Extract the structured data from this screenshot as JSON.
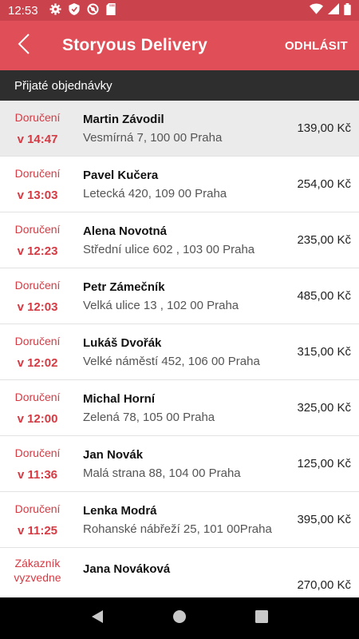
{
  "status_bar": {
    "time": "12:53",
    "icons": [
      "gear-icon",
      "shield-icon",
      "no-tracking-icon",
      "sd-card-icon"
    ],
    "right_icons": [
      "wifi-icon",
      "signal-icon",
      "battery-icon"
    ]
  },
  "app_bar": {
    "title": "Storyous Delivery",
    "logout_label": "ODHLÁSIT",
    "color": "#e04f57"
  },
  "section": {
    "title": "Přijaté objednávky"
  },
  "orders": [
    {
      "type": "Doručení",
      "time": "v 14:47",
      "name": "Martin Závodil",
      "address": "Vesmírná 7, 100 00 Praha",
      "price": "139,00 Kč"
    },
    {
      "type": "Doručení",
      "time": "v 13:03",
      "name": "Pavel Kučera",
      "address": "Letecká 420, 109 00 Praha",
      "price": "254,00 Kč"
    },
    {
      "type": "Doručení",
      "time": "v 12:23",
      "name": "Alena Novotná",
      "address": "Střední ulice 602 , 103 00 Praha",
      "price": "235,00 Kč"
    },
    {
      "type": "Doručení",
      "time": "v 12:03",
      "name": "Petr Zámečník",
      "address": "Velká ulice 13 , 102 00 Praha",
      "price": "485,00 Kč"
    },
    {
      "type": "Doručení",
      "time": "v 12:02",
      "name": "Lukáš Dvořák",
      "address": "Velké náměstí 452, 106 00 Praha",
      "price": "315,00 Kč"
    },
    {
      "type": "Doručení",
      "time": "v 12:00",
      "name": "Michal Horní",
      "address": "Zelená 78, 105 00 Praha",
      "price": "325,00 Kč"
    },
    {
      "type": "Doručení",
      "time": "v 11:36",
      "name": "Jan Novák",
      "address": "Malá strana 88, 104 00 Praha",
      "price": "125,00 Kč"
    },
    {
      "type": "Doručení",
      "time": "v 11:25",
      "name": "Lenka Modrá",
      "address": "Rohanské nábřeží 25, 101 00Praha",
      "price": "395,00 Kč"
    },
    {
      "type": "Zákazník vyzvedne",
      "time": "",
      "name": "Jana Nováková",
      "address": "",
      "price": "270,00 Kč"
    }
  ],
  "nav_bar": {
    "buttons": [
      "back-triangle-icon",
      "home-circle-icon",
      "recents-square-icon"
    ]
  }
}
